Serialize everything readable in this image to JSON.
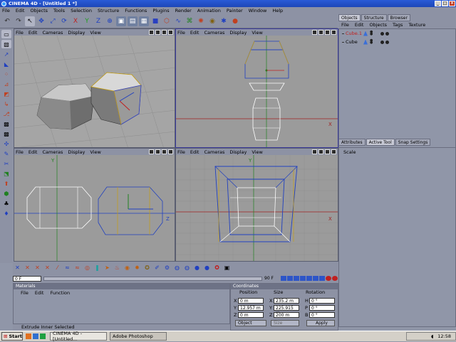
{
  "window": {
    "title": "CINEMA 4D - [Untitled 1 *]"
  },
  "menu": [
    "File",
    "Edit",
    "Objects",
    "Tools",
    "Selection",
    "Structure",
    "Functions",
    "Plugins",
    "Render",
    "Animation",
    "Painter",
    "Window",
    "Help"
  ],
  "viewport_menu": {
    "title": "View",
    "items": [
      "File",
      "Edit",
      "Cameras",
      "Display",
      "View"
    ]
  },
  "viewports": {
    "front_x_label": "X",
    "front_y_label": "Y",
    "side_z_label": "Z",
    "side_y_label": "Y",
    "top_x_label": "X",
    "top_z_label": "Z"
  },
  "right_panel": {
    "tabs": [
      "Objects",
      "Structure",
      "Browser"
    ],
    "menu": [
      "File",
      "Edit",
      "Objects",
      "Tags",
      "Texture"
    ],
    "objects": [
      {
        "name": "Cube.1",
        "color": "#c02020"
      },
      {
        "name": "Cube",
        "color": "#000000"
      }
    ],
    "attr_tabs": [
      "Attributes",
      "Active Tool",
      "Snap Settings"
    ],
    "attr_label": "Scale"
  },
  "timeline": {
    "frame": "0 F",
    "end": "90 F"
  },
  "materials": {
    "title": "Materials",
    "menu": [
      "File",
      "Edit",
      "Function"
    ]
  },
  "status": "Extrude Inner Selected",
  "coordinates": {
    "title": "Coordinates",
    "headers": [
      "Position",
      "Size",
      "Rotation"
    ],
    "rows": [
      {
        "axis": "X",
        "pos": "0 m",
        "size_axis": "X",
        "size": "235.2 m",
        "rot_axis": "H",
        "rot": "0 °"
      },
      {
        "axis": "Y",
        "pos": "12.957 m",
        "size_axis": "Y",
        "size": "225.915 m",
        "rot_axis": "P",
        "rot": "0 °"
      },
      {
        "axis": "Z",
        "pos": "0 m",
        "size_axis": "Z",
        "size": "200 m",
        "rot_axis": "B",
        "rot": "0 °"
      }
    ],
    "mode": "Object",
    "size_mode": "Size",
    "apply": "Apply"
  },
  "taskbar": {
    "start": "Start",
    "tasks": [
      "CINEMA 4D - [Untitled...",
      "Adobe Photoshop"
    ],
    "clock": "12:58"
  }
}
